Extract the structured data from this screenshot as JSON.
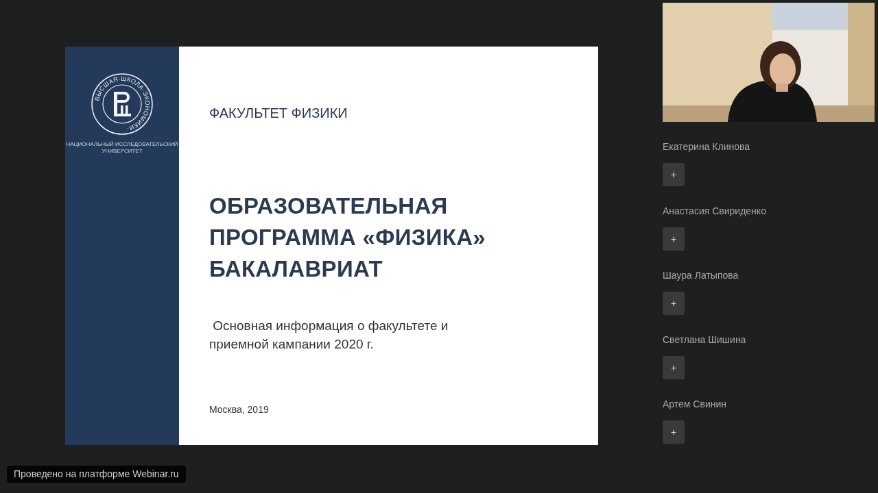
{
  "slide": {
    "logo_ring_text": "ВЫСШАЯ·ШКОЛА·ЭКОНОМИКИ·",
    "logo_caption": [
      "НАЦИОНАЛЬНЫЙ ИССЛЕДОВАТЕЛЬСКИЙ",
      "УНИВЕРСИТЕТ"
    ],
    "faculty": "ФАКУЛЬТЕТ ФИЗИКИ",
    "title": [
      "ОБРАЗОВАТЕЛЬНАЯ",
      "ПРОГРАММА «ФИЗИКА»",
      "БАКАЛАВРИАТ"
    ],
    "subtitle": [
      " Основная информация о факультете и",
      "приемной кампании 2020 г."
    ],
    "footer": "Москва, 2019"
  },
  "participants": [
    {
      "name": "Екатерина Клинова",
      "button": "+"
    },
    {
      "name": "Анастасия Свириденко",
      "button": "+"
    },
    {
      "name": "Шаура Латыпова",
      "button": "+"
    },
    {
      "name": "Светлана Шишина",
      "button": "+"
    },
    {
      "name": "Артем Свинин",
      "button": "+"
    }
  ],
  "platform_badge": "Проведено на платформе Webinar.ru"
}
